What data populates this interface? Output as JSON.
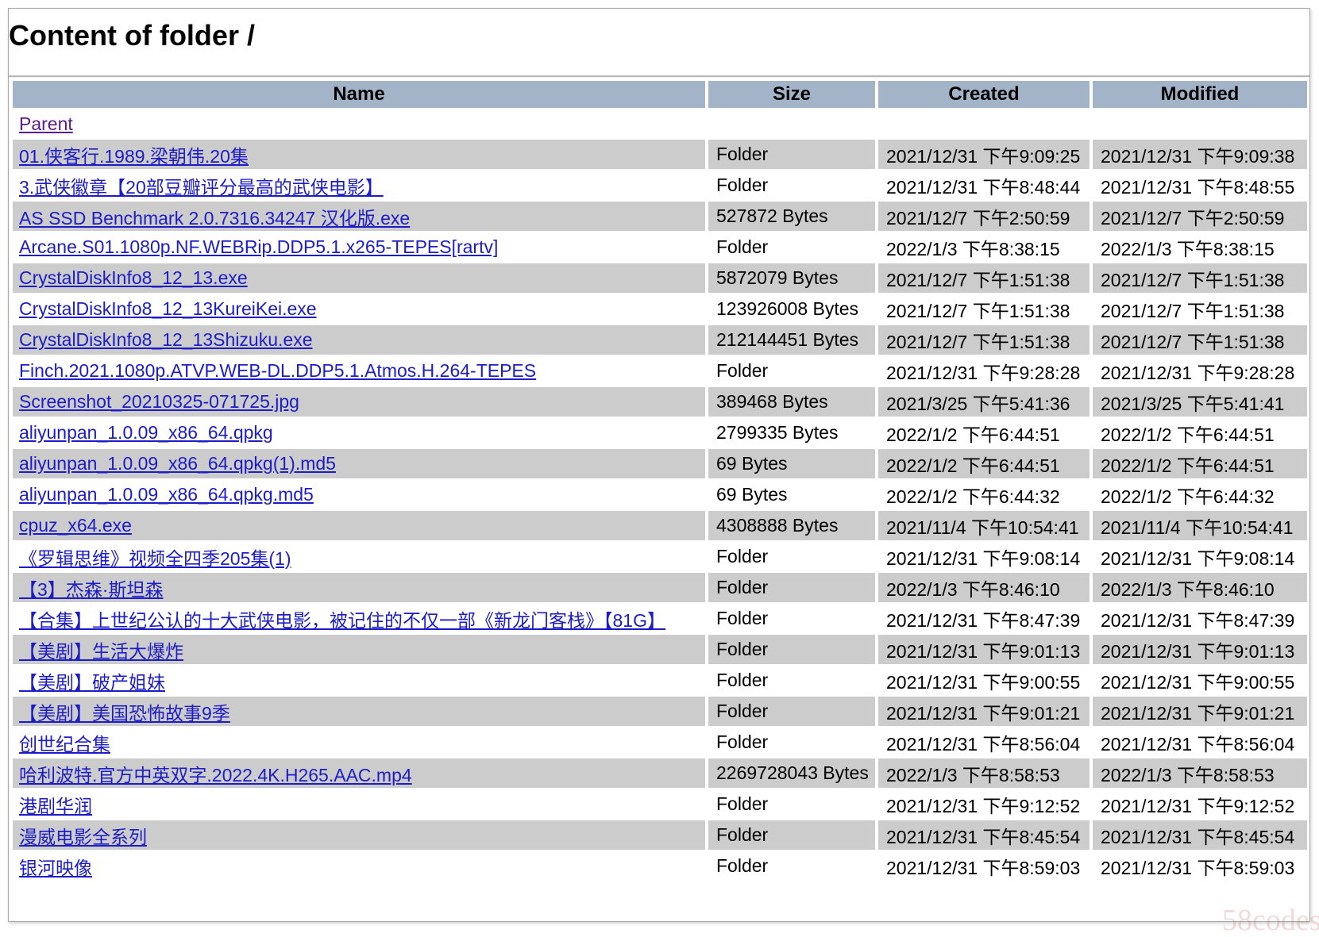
{
  "page": {
    "heading": "Content of folder /",
    "watermark": "58codes"
  },
  "table": {
    "headers": {
      "name": "Name",
      "size": "Size",
      "created": "Created",
      "modified": "Modified"
    },
    "parent_link": "Parent",
    "rows": [
      {
        "name": "01.侠客行.1989.梁朝伟.20集",
        "size": "Folder",
        "created": "2021/12/31 下午9:09:25",
        "modified": "2021/12/31 下午9:09:38"
      },
      {
        "name": "3.武侠徽章【20部豆瓣评分最高的武侠电影】",
        "size": "Folder",
        "created": "2021/12/31 下午8:48:44",
        "modified": "2021/12/31 下午8:48:55"
      },
      {
        "name": "AS SSD Benchmark 2.0.7316.34247 汉化版.exe",
        "size": "527872 Bytes",
        "created": "2021/12/7 下午2:50:59",
        "modified": "2021/12/7 下午2:50:59"
      },
      {
        "name": "Arcane.S01.1080p.NF.WEBRip.DDP5.1.x265-TEPES[rartv]",
        "size": "Folder",
        "created": "2022/1/3 下午8:38:15",
        "modified": "2022/1/3 下午8:38:15"
      },
      {
        "name": "CrystalDiskInfo8_12_13.exe",
        "size": "5872079 Bytes",
        "created": "2021/12/7 下午1:51:38",
        "modified": "2021/12/7 下午1:51:38"
      },
      {
        "name": "CrystalDiskInfo8_12_13KureiKei.exe",
        "size": "123926008 Bytes",
        "created": "2021/12/7 下午1:51:38",
        "modified": "2021/12/7 下午1:51:38"
      },
      {
        "name": "CrystalDiskInfo8_12_13Shizuku.exe",
        "size": "212144451 Bytes",
        "created": "2021/12/7 下午1:51:38",
        "modified": "2021/12/7 下午1:51:38"
      },
      {
        "name": "Finch.2021.1080p.ATVP.WEB-DL.DDP5.1.Atmos.H.264-TEPES",
        "size": "Folder",
        "created": "2021/12/31 下午9:28:28",
        "modified": "2021/12/31 下午9:28:28"
      },
      {
        "name": "Screenshot_20210325-071725.jpg",
        "size": "389468 Bytes",
        "created": "2021/3/25 下午5:41:36",
        "modified": "2021/3/25 下午5:41:41"
      },
      {
        "name": "aliyunpan_1.0.09_x86_64.qpkg",
        "size": "2799335 Bytes",
        "created": "2022/1/2 下午6:44:51",
        "modified": "2022/1/2 下午6:44:51"
      },
      {
        "name": "aliyunpan_1.0.09_x86_64.qpkg(1).md5",
        "size": "69 Bytes",
        "created": "2022/1/2 下午6:44:51",
        "modified": "2022/1/2 下午6:44:51"
      },
      {
        "name": "aliyunpan_1.0.09_x86_64.qpkg.md5",
        "size": "69 Bytes",
        "created": "2022/1/2 下午6:44:32",
        "modified": "2022/1/2 下午6:44:32"
      },
      {
        "name": "cpuz_x64.exe",
        "size": "4308888 Bytes",
        "created": "2021/11/4 下午10:54:41",
        "modified": "2021/11/4 下午10:54:41"
      },
      {
        "name": "《罗辑思维》视频全四季205集(1)",
        "size": "Folder",
        "created": "2021/12/31 下午9:08:14",
        "modified": "2021/12/31 下午9:08:14"
      },
      {
        "name": "【3】杰森·斯坦森",
        "size": "Folder",
        "created": "2022/1/3 下午8:46:10",
        "modified": "2022/1/3 下午8:46:10"
      },
      {
        "name": "【合集】上世纪公认的十大武侠电影，被记住的不仅一部《新龙门客栈》【81G】",
        "size": "Folder",
        "created": "2021/12/31 下午8:47:39",
        "modified": "2021/12/31 下午8:47:39"
      },
      {
        "name": "【美剧】生活大爆炸",
        "size": "Folder",
        "created": "2021/12/31 下午9:01:13",
        "modified": "2021/12/31 下午9:01:13"
      },
      {
        "name": "【美剧】破产姐妹",
        "size": "Folder",
        "created": "2021/12/31 下午9:00:55",
        "modified": "2021/12/31 下午9:00:55"
      },
      {
        "name": "【美剧】美国恐怖故事9季",
        "size": "Folder",
        "created": "2021/12/31 下午9:01:21",
        "modified": "2021/12/31 下午9:01:21"
      },
      {
        "name": "创世纪合集",
        "size": "Folder",
        "created": "2021/12/31 下午8:56:04",
        "modified": "2021/12/31 下午8:56:04"
      },
      {
        "name": "哈利波特.官方中英双字.2022.4K.H265.AAC.mp4",
        "size": "2269728043 Bytes",
        "created": "2022/1/3 下午8:58:53",
        "modified": "2022/1/3 下午8:58:53"
      },
      {
        "name": "港剧华润",
        "size": "Folder",
        "created": "2021/12/31 下午9:12:52",
        "modified": "2021/12/31 下午9:12:52"
      },
      {
        "name": "漫威电影全系列",
        "size": "Folder",
        "created": "2021/12/31 下午8:45:54",
        "modified": "2021/12/31 下午8:45:54"
      },
      {
        "name": "银河映像",
        "size": "Folder",
        "created": "2021/12/31 下午8:59:03",
        "modified": "2021/12/31 下午8:59:03"
      }
    ]
  }
}
